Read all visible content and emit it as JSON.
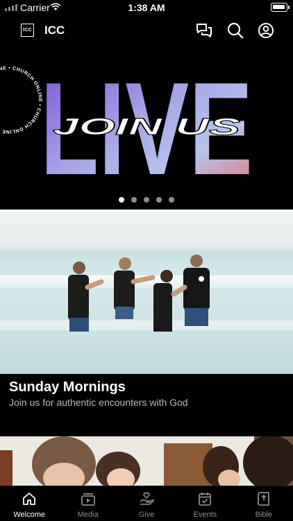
{
  "status_bar": {
    "carrier": "Carrier",
    "time": "1:38 AM"
  },
  "header": {
    "logo_text": "ICC",
    "title": "ICC"
  },
  "hero": {
    "big_text": "LIVE",
    "overlay_text": "JOIN US",
    "ring_text": "CHURCH ONLINE • CHURCH ONLINE • CHURCH ONLINE • CHURCH ONLINE • ",
    "slide_count": 5,
    "active_slide": 1
  },
  "card": {
    "title": "Sunday Mornings",
    "subtitle": "Join us for authentic encounters with God"
  },
  "tabs": [
    {
      "label": "Welcome",
      "icon": "home-icon",
      "active": true
    },
    {
      "label": "Media",
      "icon": "media-play-icon",
      "active": false
    },
    {
      "label": "Give",
      "icon": "give-hand-icon",
      "active": false
    },
    {
      "label": "Events",
      "icon": "calendar-check-icon",
      "active": false
    },
    {
      "label": "Bible",
      "icon": "bible-icon",
      "active": false
    }
  ],
  "colors": {
    "background": "#000000",
    "live_gradient_start": "#7b4fd6",
    "live_gradient_mid": "#a8a5e6",
    "live_gradient_end": "#e86f6f",
    "tab_inactive": "#8c8c8c"
  }
}
